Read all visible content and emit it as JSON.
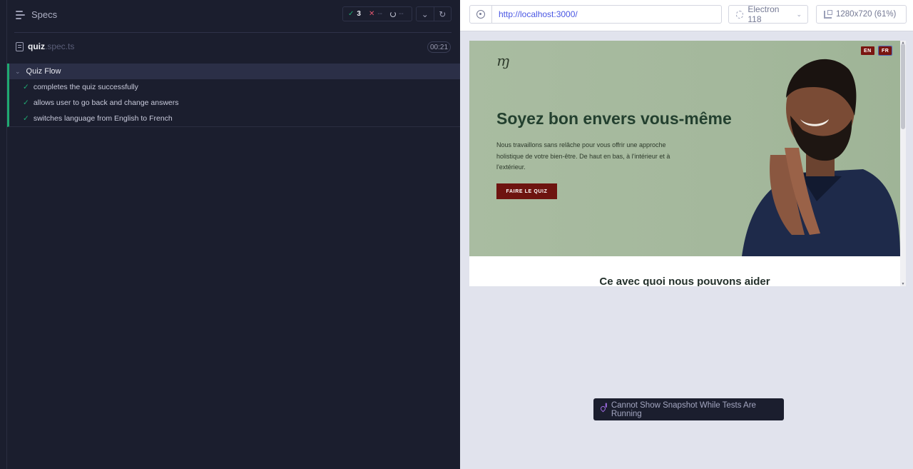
{
  "reporter": {
    "header_title": "Specs",
    "stats": {
      "passed": "3",
      "failed": "--",
      "pending": "--"
    },
    "spec": {
      "name": "quiz",
      "ext": ".spec.ts",
      "duration": "00:21"
    },
    "suite": "Quiz Flow",
    "tests": [
      "completes the quiz successfully",
      "allows user to go back and change answers",
      "switches language from English to French"
    ]
  },
  "aut": {
    "url": "http://localhost:3000/",
    "browser": "Electron 118",
    "viewport": "1280x720 (61%)",
    "snapshot_message": "Cannot Show Snapshot While Tests Are Running"
  },
  "site": {
    "logo": "ɱ",
    "lang_en": "EN",
    "lang_fr": "FR",
    "hero_title": "Soyez bon envers vous-même",
    "hero_text": "Nous travaillons sans relâche pour vous offrir une approche holistique de votre bien-être. De haut en bas, à l'intérieur et à l'extérieur.",
    "cta": "FAIRE LE QUIZ",
    "section_title": "Ce avec quoi nous pouvons aider"
  },
  "colors": {
    "pass": "#1fa971",
    "fail": "#e45770",
    "cta": "#6e1410",
    "hero_bg": "#a9bca1",
    "url": "#4956e3"
  }
}
